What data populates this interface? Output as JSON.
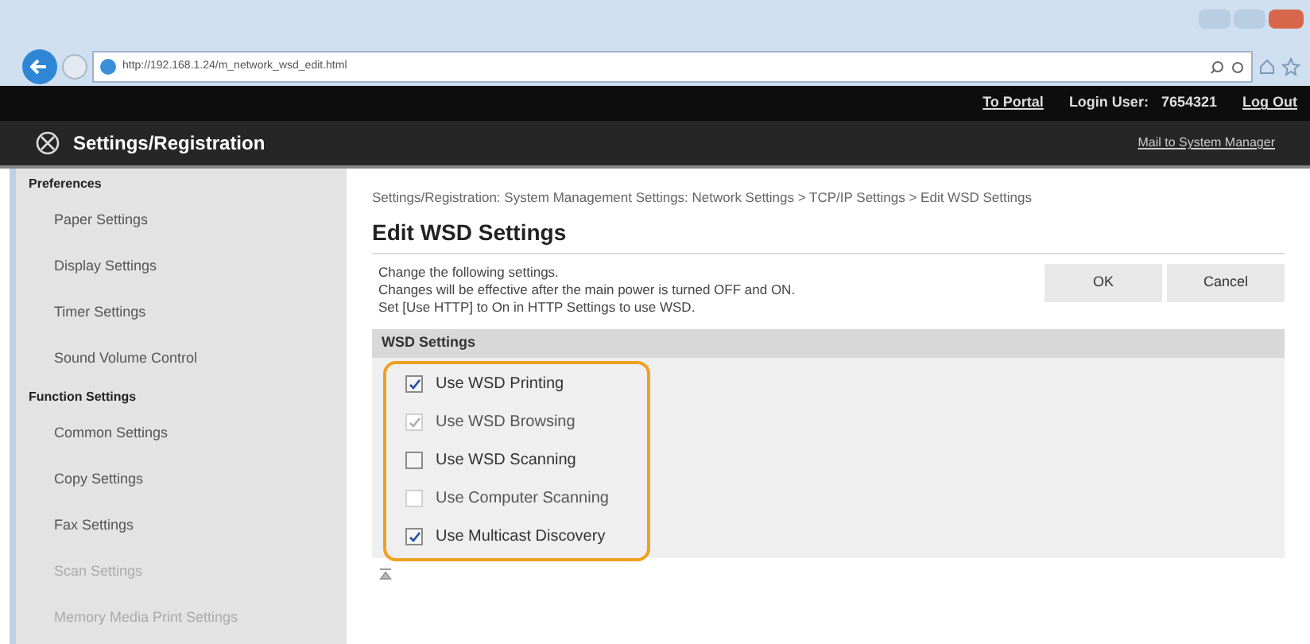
{
  "browser": {
    "url": "http://192.168.1.24/m_network_wsd_edit.html"
  },
  "top_bar": {
    "links": [
      "To Portal",
      "Log Out"
    ],
    "login_label": "Login User:",
    "login_user": "7654321"
  },
  "header": {
    "title": "Settings/Registration",
    "link": "Mail to System Manager"
  },
  "sidebar": [
    {
      "heading": "Preferences",
      "items": [
        "Paper Settings",
        "Display Settings",
        "Timer Settings",
        "Sound Volume Control"
      ]
    },
    {
      "heading": "Function Settings",
      "items": [
        "Common Settings",
        "Copy Settings",
        "Fax Settings",
        "Scan Settings",
        "Memory Media Print Settings"
      ]
    }
  ],
  "breadcrumb": "Settings/Registration: System Management Settings: Network Settings > TCP/IP Settings > Edit WSD Settings",
  "page_title": "Edit WSD Settings",
  "instructions": [
    "Change the following settings.",
    "Changes will be effective after the main power is turned OFF and ON.",
    "Set [Use HTTP] to On in HTTP Settings to use WSD."
  ],
  "buttons": [
    "OK",
    "Cancel"
  ],
  "section": {
    "title": "WSD Settings",
    "options": [
      {
        "label": "Use WSD Printing",
        "checked": true,
        "disabled": false
      },
      {
        "label": "Use WSD Browsing",
        "checked": true,
        "disabled": true
      },
      {
        "label": "Use WSD Scanning",
        "checked": false,
        "disabled": false
      },
      {
        "label": "Use Computer Scanning",
        "checked": false,
        "disabled": true
      },
      {
        "label": "Use Multicast Discovery",
        "checked": true,
        "disabled": false
      }
    ]
  }
}
